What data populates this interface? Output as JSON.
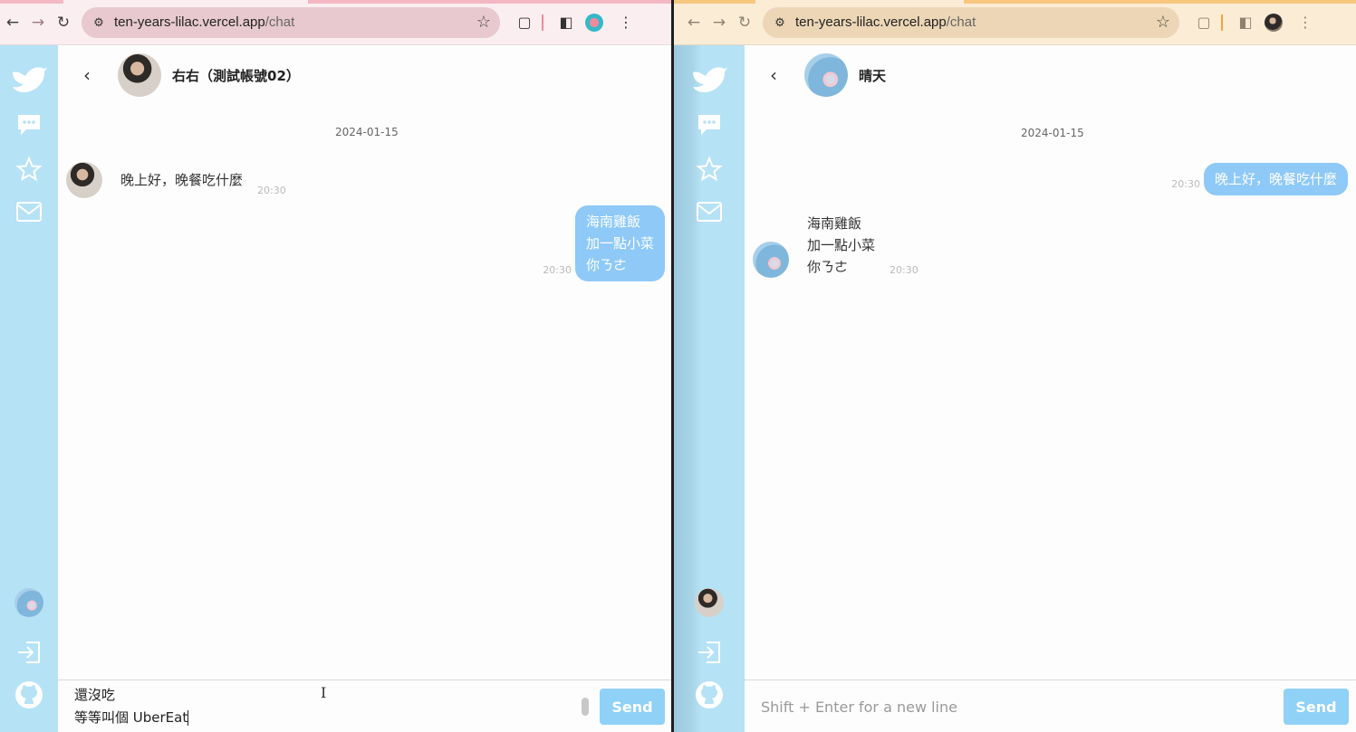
{
  "left_window": {
    "browser": {
      "url_host": "ten-years-lilac.vercel.app",
      "url_path": "/chat"
    },
    "chat": {
      "partner_name": "右右（測試帳號02）",
      "date": "2024-01-15",
      "messages": [
        {
          "direction": "incoming",
          "text": "晚上好，晚餐吃什麼",
          "time": "20:30"
        },
        {
          "direction": "outgoing",
          "text": "海南雞飯\n加一點小菜\n你ㄋㄜ",
          "time": "20:30"
        }
      ],
      "composer_value": "還沒吃\n等等叫個 UberEat",
      "send_label": "Send"
    }
  },
  "right_window": {
    "browser": {
      "url_host": "ten-years-lilac.vercel.app",
      "url_path": "/chat"
    },
    "chat": {
      "partner_name": "晴天",
      "date": "2024-01-15",
      "messages": [
        {
          "direction": "outgoing",
          "text": "晚上好，晚餐吃什麼",
          "time": "20:30"
        },
        {
          "direction": "incoming",
          "text": "海南雞飯\n加一點小菜\n你ㄋㄜ",
          "time": "20:30"
        }
      ],
      "composer_placeholder": "Shift + Enter for a new line",
      "send_label": "Send"
    }
  },
  "icons": {
    "sidebar": [
      "bird-logo-icon",
      "chat-bubble-icon",
      "star-icon",
      "mail-icon",
      "user-avatar",
      "logout-icon",
      "github-icon"
    ],
    "toolbar": [
      "back-arrow-icon",
      "forward-arrow-icon",
      "reload-icon",
      "site-info-icon",
      "bookmark-star-icon",
      "extensions-icon",
      "side-panel-icon",
      "profile-icon",
      "menu-icon"
    ]
  },
  "colors": {
    "sidebar_bg": "#b6e2f6",
    "outgoing_bubble": "#8ec9f7",
    "send_button": "#8fd1f7",
    "left_chrome": "#fbeef0",
    "right_chrome": "#fbecd6"
  }
}
